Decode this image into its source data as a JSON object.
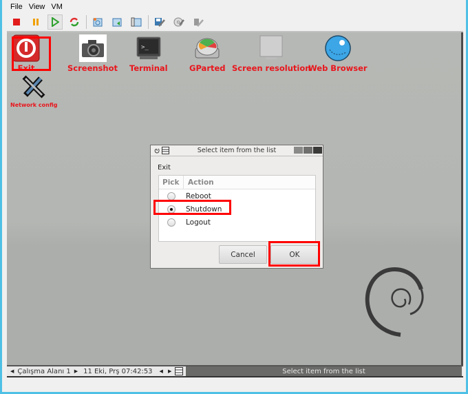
{
  "menu": {
    "items": [
      "File",
      "View",
      "VM"
    ]
  },
  "toolbar": {
    "buttons": [
      {
        "name": "stop-icon",
        "color": "#e21b1b"
      },
      {
        "name": "pause-icon",
        "color": "#f0a000"
      },
      {
        "name": "play-icon",
        "color": "#2fa12f"
      },
      {
        "name": "reset-icon",
        "color": "#e23030"
      },
      {
        "name": "snapshot-icon"
      },
      {
        "name": "revert-snapshot-icon"
      },
      {
        "name": "manage-snapshots-icon"
      },
      {
        "name": "settings-icon"
      },
      {
        "name": "insert-disk-icon"
      },
      {
        "name": "usb-settings-icon"
      }
    ]
  },
  "desktop": {
    "icons": [
      {
        "id": "exit",
        "label": "Exit",
        "icon": "power-icon"
      },
      {
        "id": "screenshot",
        "label": "Screenshot",
        "icon": "camera-icon"
      },
      {
        "id": "terminal",
        "label": "Terminal",
        "icon": "terminal-icon"
      },
      {
        "id": "gparted",
        "label": "GParted",
        "icon": "disk-icon"
      },
      {
        "id": "screen-resolution",
        "label": "Screen resolution",
        "icon": "monitor-icon"
      },
      {
        "id": "web-browser",
        "label": "Web Browser",
        "icon": "globe-icon"
      },
      {
        "id": "network-config",
        "label": "Network config",
        "icon": "tools-icon"
      }
    ],
    "label_color": "#e8161c"
  },
  "dialog": {
    "title": "Select item from the list",
    "prompt": "Exit",
    "columns": [
      "Pick",
      "Action"
    ],
    "rows": [
      {
        "label": "Reboot",
        "checked": false
      },
      {
        "label": "Shutdown",
        "checked": true
      },
      {
        "label": "Logout",
        "checked": false
      }
    ],
    "cancel_label": "Cancel",
    "ok_label": "OK"
  },
  "taskbar": {
    "workspace": "Çalışma Alanı 1",
    "clock": "11 Eki, Prş 07:42:53",
    "active_task": "Select item from the list"
  },
  "highlight_color": "#ff0000"
}
